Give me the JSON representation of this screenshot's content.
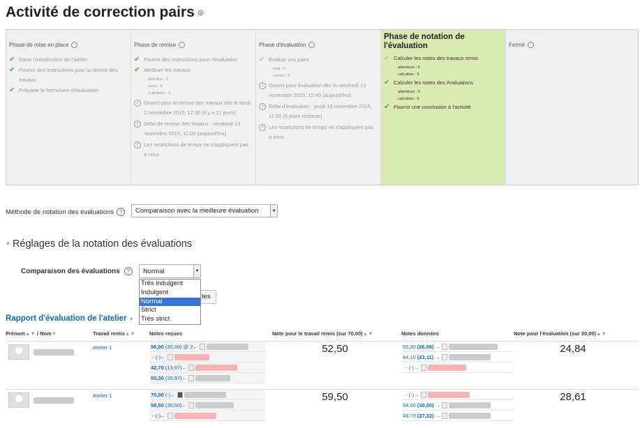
{
  "page": {
    "title": "Activité de correction pairs"
  },
  "phases": [
    {
      "name": "Phase de mise en place",
      "tasks": [
        "Saisir l'introduction de l'atelier",
        "Fournir des instructions pour la remise des travaux",
        "Préparer le formulaire d'évaluation"
      ],
      "infos": []
    },
    {
      "name": "Phase de remise",
      "tasks": [
        "Fournir des instructions pour l'évaluation",
        "Attribuer les travaux"
      ],
      "subs": [
        "attendus : 6",
        "remis : 6",
        "à attribuer : 0"
      ],
      "infos": [
        "Ouvert pour la remise des travaux dès le lundi 2 novembre 2015, 17:30 (il y a 11 jours)",
        "Délai de remise des travaux : vendredi 13 novembre 2015, 11:00 (aujourd'hui)",
        "Les restrictions de temps ne s'appliquent pas à vous"
      ]
    },
    {
      "name": "Phase d'évaluation",
      "tasks": [
        "Évaluer vos pairs"
      ],
      "subs": [
        "total : 0",
        "restant : 0"
      ],
      "infos": [
        "Ouvert pour évaluation dès le vendredi 13 novembre 2015, 12:45 (aujourd'hui)",
        "Délai d'évaluation : jeudi 19 novembre 2015, 11:00 (6 jours restants)",
        "Les restrictions de temps ne s'appliquent pas à vous"
      ]
    },
    {
      "name": "Phase de notation de l'évaluation",
      "tasks": [
        "Calculer les notes des travaux remis",
        "Calculer les notes des évaluations",
        "Fournir une conclusion à l'activité"
      ],
      "subs1": [
        "attendues : 6",
        "calculées : 5"
      ],
      "subs2": [
        "attendues : 6",
        "calculées : 6"
      ],
      "infos": []
    },
    {
      "name": "Fermé",
      "tasks": [],
      "infos": []
    }
  ],
  "method": {
    "label": "Méthode de notation des évaluations",
    "value": "Comparaison avec la meilleure évaluation"
  },
  "settings": {
    "heading": "Réglages de la notation des évaluations",
    "compare_label": "Comparaison des évaluations",
    "compare_value": "Normal",
    "options": [
      "Très indulgent",
      "Indulgent",
      "Normal",
      "Strict",
      "Très strict"
    ],
    "button_tail": "tes"
  },
  "report": {
    "heading": "Rapport d'évaluation de l'atelier",
    "columns": {
      "name": "Prénom",
      "name_sep": "/",
      "name2": "Nom",
      "submission": "Travail remis",
      "received": "Notes reçues",
      "grade_sub": "Note pour le travail remis (sur 70,00)",
      "given": "Notes données",
      "grade_eval": "Note pour l'évaluation (sur 30,00)"
    },
    "rows": [
      {
        "submission": "Atelier 1",
        "grade": "52,50",
        "eval_grade": "24,84",
        "received": [
          {
            "main": "56,00",
            "rest": "(30,00) @ 2←"
          },
          {
            "main": "",
            "rest": "- (-)←"
          },
          {
            "main": "42,70",
            "rest": "(13,97)←"
          },
          {
            "main": "55,30",
            "rest": "(25,97)←"
          }
        ],
        "given": [
          {
            "main": "55,30",
            "bold": "(26,56)",
            "rest": "→"
          },
          {
            "main": "44,10",
            "bold": "(23,11)",
            "rest": "→"
          },
          {
            "main": "",
            "bold": "",
            "rest": "- (-)→"
          }
        ]
      },
      {
        "submission": "Atelier 1",
        "grade": "59,50",
        "eval_grade": "28,61",
        "received": [
          {
            "main": "70,00",
            "rest": "(-)←"
          },
          {
            "main": "59,50",
            "rest": "(30,00)←"
          },
          {
            "main": "",
            "rest": "- (-)←"
          }
        ],
        "given": [
          {
            "main": "",
            "bold": "",
            "rest": "- (-)→"
          },
          {
            "main": "54,60",
            "bold": "(30,00)",
            "rest": "→"
          },
          {
            "main": "49,70",
            "bold": "(27,22)",
            "rest": "→"
          }
        ]
      }
    ]
  }
}
